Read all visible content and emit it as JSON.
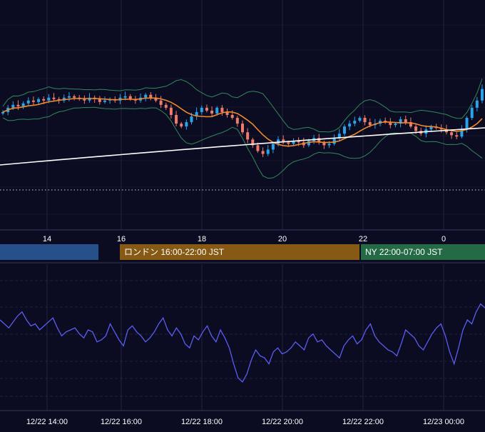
{
  "chart_data": [
    {
      "type": "candlestick",
      "panel": "price",
      "x_ticks": [
        "14",
        "16",
        "18",
        "20",
        "22",
        "0"
      ],
      "grid": true,
      "colors": {
        "background": "#0b0b22",
        "up": "#29a3ea",
        "down": "#ef7b6b",
        "ma_short": "#f0892a",
        "ma_long": "#ffffff",
        "bollinger": "#2f8a58",
        "grid": "#2a2a45"
      },
      "indicators": [
        "moving-average-short",
        "moving-average-long",
        "bollinger-bands",
        "dotted-price-line"
      ],
      "sessions": [
        {
          "label": "",
          "color": "#25508a"
        },
        {
          "label": "ロンドン 16:00-22:00 JST",
          "color": "#865a14"
        },
        {
          "label": "NY 22:00-07:00 JST",
          "color": "#236a45"
        }
      ],
      "close_series": [
        0.52,
        0.55,
        0.57,
        0.56,
        0.58,
        0.6,
        0.59,
        0.61,
        0.6,
        0.62,
        0.61,
        0.6,
        0.62,
        0.63,
        0.62,
        0.61,
        0.6,
        0.62,
        0.61,
        0.59,
        0.6,
        0.61,
        0.6,
        0.62,
        0.63,
        0.61,
        0.6,
        0.62,
        0.64,
        0.62,
        0.6,
        0.57,
        0.55,
        0.5,
        0.44,
        0.42,
        0.45,
        0.49,
        0.52,
        0.55,
        0.53,
        0.51,
        0.55,
        0.52,
        0.5,
        0.48,
        0.44,
        0.38,
        0.33,
        0.29,
        0.25,
        0.23,
        0.26,
        0.3,
        0.33,
        0.31,
        0.3,
        0.32,
        0.31,
        0.29,
        0.32,
        0.34,
        0.31,
        0.29,
        0.3,
        0.34,
        0.37,
        0.42,
        0.44,
        0.46,
        0.48,
        0.45,
        0.43,
        0.44,
        0.46,
        0.45,
        0.43,
        0.44,
        0.47,
        0.45,
        0.42,
        0.39,
        0.37,
        0.4,
        0.42,
        0.41,
        0.4,
        0.38,
        0.36,
        0.35,
        0.4,
        0.48,
        0.55,
        0.6,
        0.68
      ]
    },
    {
      "type": "line",
      "panel": "oscillator",
      "x_ticks": [
        "12/22 14:00",
        "12/22 16:00",
        "12/22 18:00",
        "12/22 20:00",
        "12/22 22:00",
        "12/23 00:00"
      ],
      "grid": true,
      "colors": {
        "line": "#5a5ef0",
        "grid": "#2a2a45"
      },
      "values": [
        60,
        58,
        56,
        59,
        62,
        64,
        60,
        57,
        58,
        55,
        57,
        59,
        61,
        56,
        52,
        54,
        55,
        56,
        53,
        51,
        55,
        54,
        49,
        50,
        52,
        58,
        54,
        50,
        47,
        55,
        57,
        54,
        52,
        49,
        51,
        54,
        58,
        61,
        55,
        52,
        56,
        53,
        48,
        46,
        52,
        50,
        54,
        57,
        52,
        49,
        55,
        51,
        46,
        38,
        31,
        29,
        33,
        40,
        45,
        42,
        41,
        38,
        44,
        46,
        43,
        44,
        46,
        49,
        47,
        45,
        51,
        53,
        49,
        50,
        47,
        45,
        43,
        41,
        47,
        50,
        52,
        48,
        50,
        55,
        58,
        52,
        49,
        47,
        45,
        44,
        42,
        48,
        55,
        53,
        51,
        47,
        45,
        49,
        53,
        56,
        58,
        52,
        44,
        38,
        46,
        55,
        60,
        58,
        64,
        68,
        66
      ]
    }
  ]
}
